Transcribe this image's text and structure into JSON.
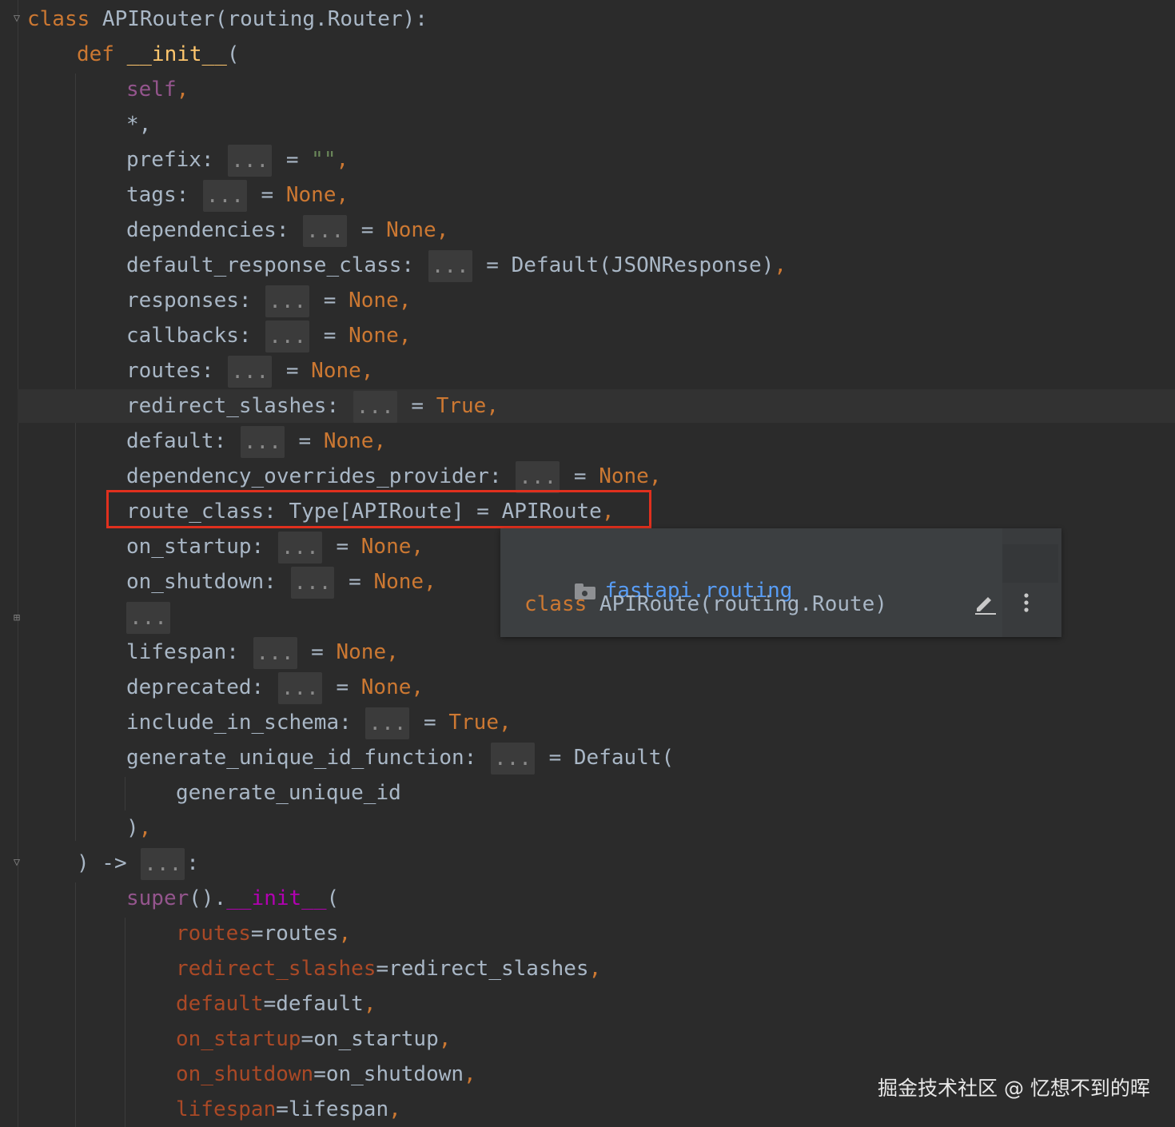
{
  "code": {
    "l1_kw": "class",
    "l1_rest": " APIRouter(routing.Router):",
    "l2_kw": "def",
    "l2_fn": "__init__",
    "l2_paren": "(",
    "self": "self",
    "self_comma": ",",
    "star": "*,",
    "prefix_name": "prefix: ",
    "prefix_eq": " = ",
    "prefix_val": "\"\"",
    "tags_name": "tags: ",
    "dependencies_name": "dependencies: ",
    "default_response_class_name": "default_response_class: ",
    "default_response_class_val": "Default(JSONResponse)",
    "responses_name": "responses: ",
    "callbacks_name": "callbacks: ",
    "routes_name": "routes: ",
    "redirect_slashes_name": "redirect_slashes: ",
    "default_name": "default: ",
    "dependency_overrides_provider_name": "dependency_overrides_provider: ",
    "route_class_line": "route_class: Type[APIRoute] = APIRoute",
    "on_startup_name": "on_startup: ",
    "on_shutdown_name": "on_shutdown: ",
    "lifespan_name": "lifespan: ",
    "deprecated_name": "deprecated: ",
    "include_in_schema_name": "include_in_schema: ",
    "generate_unique_id_function_name": "generate_unique_id_function: ",
    "generate_default_open": "Default(",
    "generate_unique_id": "generate_unique_id",
    "close_paren": ")",
    "comma": ",",
    "eq": " = ",
    "none": "None",
    "true": "True",
    "hint": "...",
    "arrow_line": ") -> ",
    "colon": ":",
    "super": "super",
    "super_call": "().",
    "super_init": "__init__",
    "kw_routes": "routes",
    "val_routes": "routes",
    "kw_redirect_slashes": "redirect_slashes",
    "val_redirect_slashes": "redirect_slashes",
    "kw_default": "default",
    "val_default": "default",
    "kw_on_startup": "on_startup",
    "val_on_startup": "on_startup",
    "kw_on_shutdown": "on_shutdown",
    "val_on_shutdown": "on_shutdown",
    "kw_lifespan": "lifespan",
    "val_lifespan": "lifespan",
    "assign": "="
  },
  "popup": {
    "package": "fastapi.routing",
    "class_kw": "class",
    "class_sig": " APIRoute(routing.Route)"
  },
  "icons": {
    "folder": "folder-icon",
    "edit": "edit-icon",
    "more": "more-vertical-icon",
    "fold_open": "fold-open-icon",
    "fold_collapsed": "fold-collapsed-icon"
  },
  "colors": {
    "background": "#2b2b2b",
    "keyword": "#cc7832",
    "text": "#a9b7c6",
    "self": "#94558d",
    "dunder": "#b200b2",
    "kwarg": "#aa4926",
    "package_link": "#589df6",
    "highlight_box": "#e0301e"
  },
  "watermark": "掘金技术社区 @ 忆想不到的晖"
}
